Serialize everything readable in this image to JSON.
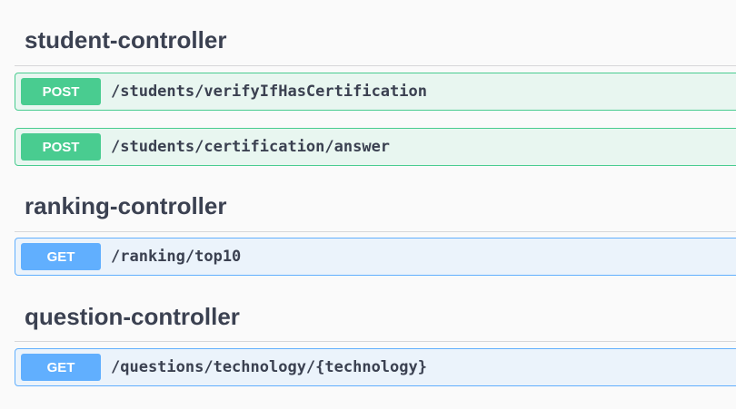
{
  "sections": [
    {
      "title": "student-controller",
      "operations": [
        {
          "method": "POST",
          "path": "/students/verifyIfHasCertification",
          "color": "#49cc90"
        },
        {
          "method": "POST",
          "path": "/students/certification/answer",
          "color": "#49cc90"
        }
      ]
    },
    {
      "title": "ranking-controller",
      "operations": [
        {
          "method": "GET",
          "path": "/ranking/top10",
          "color": "#61affe"
        }
      ]
    },
    {
      "title": "question-controller",
      "operations": [
        {
          "method": "GET",
          "path": "/questions/technology/{technology}",
          "color": "#61affe"
        }
      ]
    }
  ]
}
